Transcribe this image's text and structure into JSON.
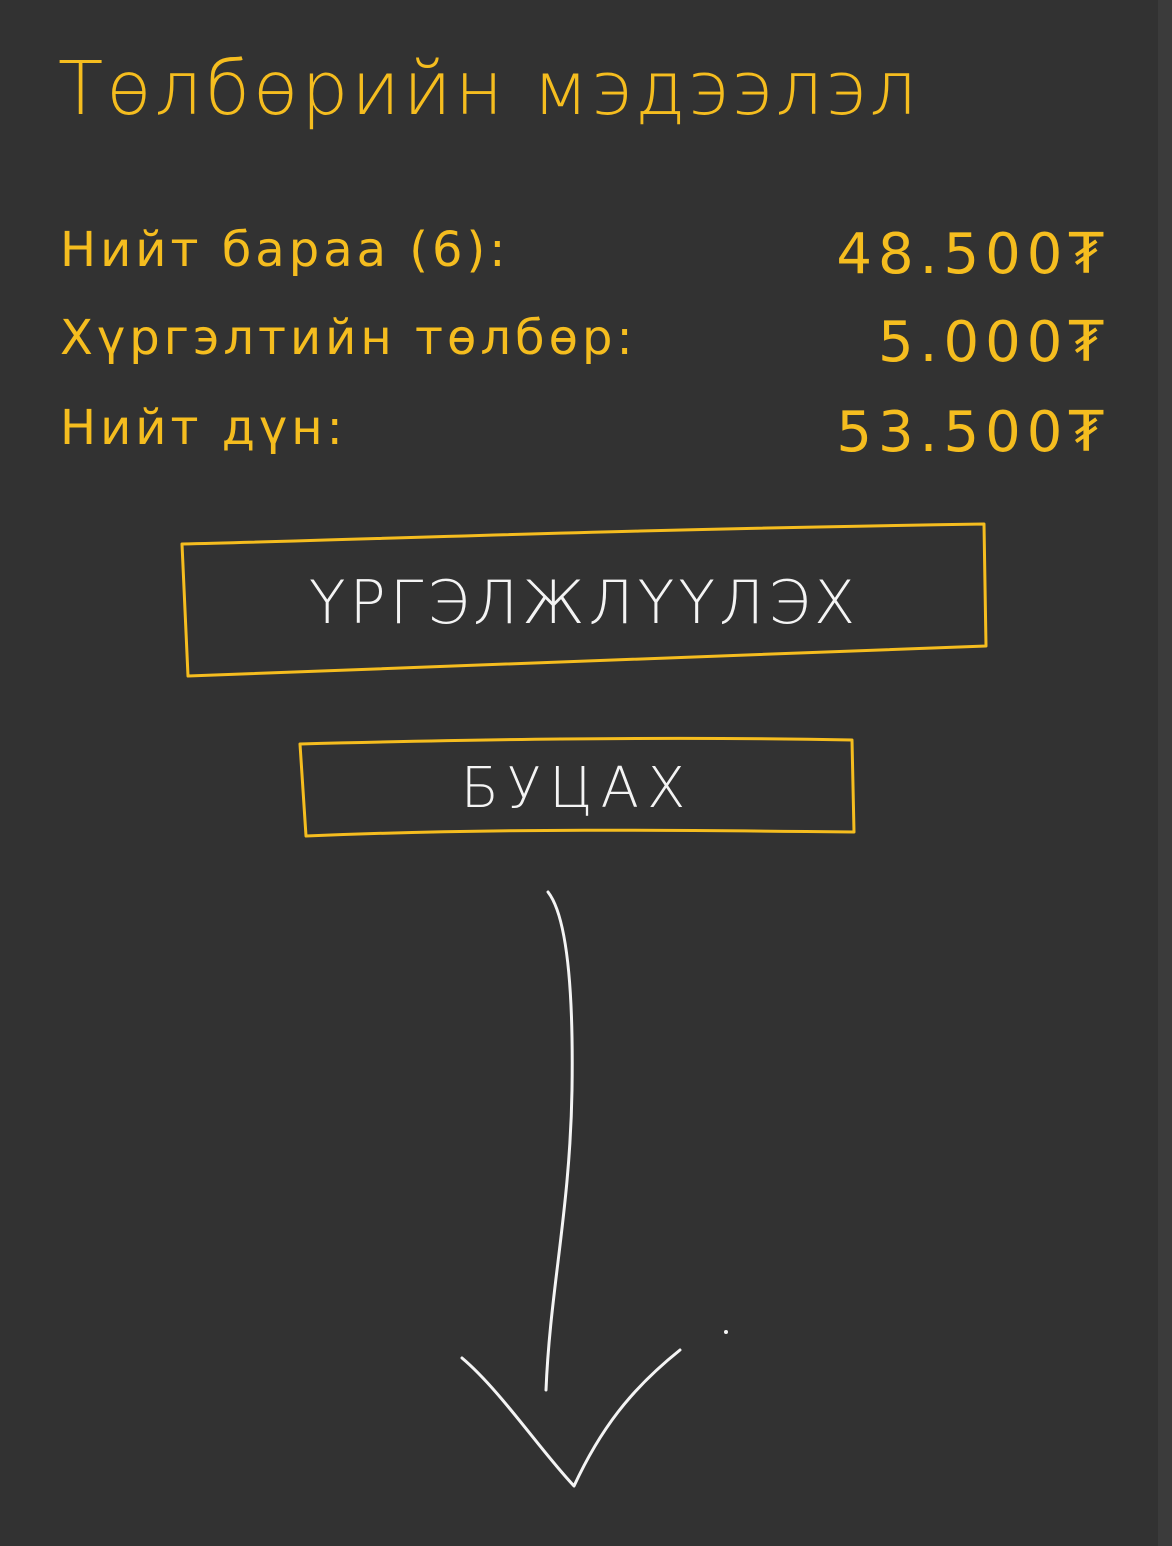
{
  "colors": {
    "background": "#323232",
    "ink_yellow": "#f5bd1f",
    "ink_white": "#f4f4f4"
  },
  "title": "Төлбөрийн мэдээлэл",
  "summary": [
    {
      "label": "Нийт бараа (6):",
      "value": "48.500₮"
    },
    {
      "label": "Хүргэлтийн төлбөр:",
      "value": "5.000₮"
    },
    {
      "label": "Нийт дүн:",
      "value": "53.500₮"
    }
  ],
  "buttons": {
    "confirm_label": "ҮРГЭЛЖЛҮҮЛЭХ",
    "cancel_label": "БУЦАХ"
  },
  "icons": {
    "scroll_arrow": "arrow-down-icon"
  }
}
